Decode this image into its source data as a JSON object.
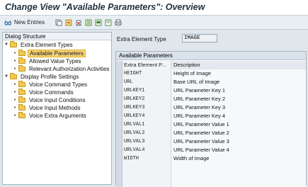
{
  "window": {
    "title": "Change View \"Available Parameters\": Overview"
  },
  "toolbar": {
    "new_entries_label": "New Entries",
    "icons": [
      "glasses-icon",
      "copy-icon",
      "undo-icon",
      "delete-icon",
      "select-all-icon",
      "select-block-icon",
      "deselect-icon",
      "print-icon"
    ]
  },
  "dialog_structure": {
    "header": "Dialog Structure",
    "nodes": [
      {
        "label": "Extra Element Types",
        "level": 0,
        "expanded": true
      },
      {
        "label": "Available Parameters",
        "level": 1,
        "selected": true
      },
      {
        "label": "Allowed Value Types",
        "level": 1
      },
      {
        "label": "Relevant Authorization Activities",
        "level": 1
      },
      {
        "label": "Display Profile Settings",
        "level": 0,
        "expanded": true
      },
      {
        "label": "Voice Command Types",
        "level": 1
      },
      {
        "label": "Voice Commands",
        "level": 1
      },
      {
        "label": "Voice Input Conditions",
        "level": 1
      },
      {
        "label": "Voice Input Methods",
        "level": 1
      },
      {
        "label": "Voice Extra Arguments",
        "level": 1
      }
    ]
  },
  "main": {
    "extra_element_type_label": "Extra Element Type",
    "extra_element_type_value": "IMAGE",
    "table_title": "Available Parameters",
    "columns": [
      "Extra Element P...",
      "Description"
    ],
    "rows": [
      {
        "key": "HEIGHT",
        "desc": "Height of Image"
      },
      {
        "key": "URL",
        "desc": "Base URL of Image"
      },
      {
        "key": "URLKEY1",
        "desc": "URL Parameter Key 1"
      },
      {
        "key": "URLKEY2",
        "desc": "URL Parameter Key 2"
      },
      {
        "key": "URLKEY3",
        "desc": "URL Parameter Key 3"
      },
      {
        "key": "URLKEY4",
        "desc": "URL Parameter Key 4"
      },
      {
        "key": "URLVAL1",
        "desc": "URL Parameter Value 1"
      },
      {
        "key": "URLVAL2",
        "desc": "URL Parameter Value 2"
      },
      {
        "key": "URLVAL3",
        "desc": "URL Parameter Value 3"
      },
      {
        "key": "URLVAL4",
        "desc": "URL Parameter Value 4"
      },
      {
        "key": "WIDTH",
        "desc": "Width of Image"
      },
      {
        "key": "",
        "desc": ""
      },
      {
        "key": "",
        "desc": ""
      },
      {
        "key": "",
        "desc": ""
      }
    ]
  }
}
